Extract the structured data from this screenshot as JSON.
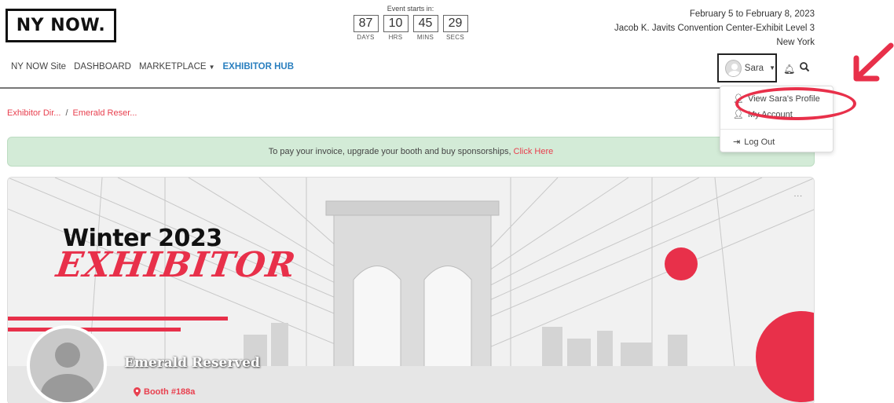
{
  "header": {
    "logo_text": "NY NOW.",
    "countdown": {
      "label": "Event starts in:",
      "units": [
        {
          "value": "87",
          "label": "DAYS"
        },
        {
          "value": "10",
          "label": "HRS"
        },
        {
          "value": "45",
          "label": "MINS"
        },
        {
          "value": "29",
          "label": "SECS"
        }
      ]
    },
    "event_info": {
      "dates": "February 5 to February 8, 2023",
      "venue": "Jacob K. Javits Convention Center-Exhibit Level 3",
      "city": "New York"
    }
  },
  "nav": {
    "items": [
      {
        "label": "NY NOW Site"
      },
      {
        "label": "DASHBOARD"
      },
      {
        "label": "MARKETPLACE"
      },
      {
        "label": "EXHIBITOR HUB"
      }
    ],
    "active_index": 3
  },
  "user": {
    "name": "Sara"
  },
  "dropdown": {
    "items": [
      {
        "label": "View Sara's Profile",
        "icon": "user-icon"
      },
      {
        "label": "My Account",
        "icon": "user-edit-icon"
      },
      {
        "label": "Log Out",
        "icon": "sign-out-icon"
      }
    ]
  },
  "breadcrumb": {
    "items": [
      "Exhibitor Dir...",
      "Emerald Reser..."
    ],
    "separator": "/"
  },
  "alert": {
    "text": "To pay your invoice, upgrade your booth and buy sponsorships,",
    "link": "Click Here"
  },
  "banner": {
    "title_line1": "Winter 2023",
    "title_line2": "EXHIBITOR",
    "more": "..."
  },
  "profile": {
    "company": "Emerald Reserved",
    "booth": "Booth #188a"
  },
  "colors": {
    "accent_red": "#e8304a",
    "link_blue": "#2a7fbf",
    "alert_green": "#d3ebd7"
  }
}
